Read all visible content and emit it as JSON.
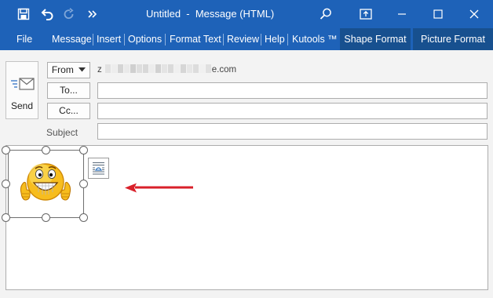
{
  "window": {
    "title": "Untitled  -  Message (HTML)"
  },
  "quick_access": {
    "icons": [
      "save-icon",
      "undo-icon",
      "redo-icon",
      "customize-icon"
    ]
  },
  "window_controls": {
    "icons": [
      "search-icon",
      "ribbon-display-icon",
      "minimize-icon",
      "maximize-icon",
      "close-icon"
    ]
  },
  "ribbon": {
    "tabs": [
      {
        "label": "File"
      },
      {
        "label": "Message"
      },
      {
        "label": "Insert"
      },
      {
        "label": "Options"
      },
      {
        "label": "Format Text"
      },
      {
        "label": "Review"
      },
      {
        "label": "Help"
      },
      {
        "label": "Kutools ™"
      }
    ],
    "context_tabs": [
      {
        "label": "Shape Format"
      },
      {
        "label": "Picture Format"
      }
    ]
  },
  "compose": {
    "send_label": "Send",
    "from_label": "From",
    "from_address_visible": "z",
    "from_address_suffix": "e.com",
    "to_label": "To...",
    "cc_label": "Cc...",
    "subject_label": "Subject",
    "to_value": "",
    "cc_value": "",
    "subject_value": ""
  },
  "body": {
    "image_name": "thumbs-up-smiley-emoji",
    "layout_options_icon": "layout-options-icon",
    "annotation": "red-arrow-pointing-left"
  },
  "colors": {
    "titlebar": "#1e62b8",
    "context_tab": "#17508f",
    "arrow": "#d9202a",
    "blur_1": "#e2e2e2",
    "blur_2": "#cfcfcf",
    "blur_3": "#ededed"
  }
}
